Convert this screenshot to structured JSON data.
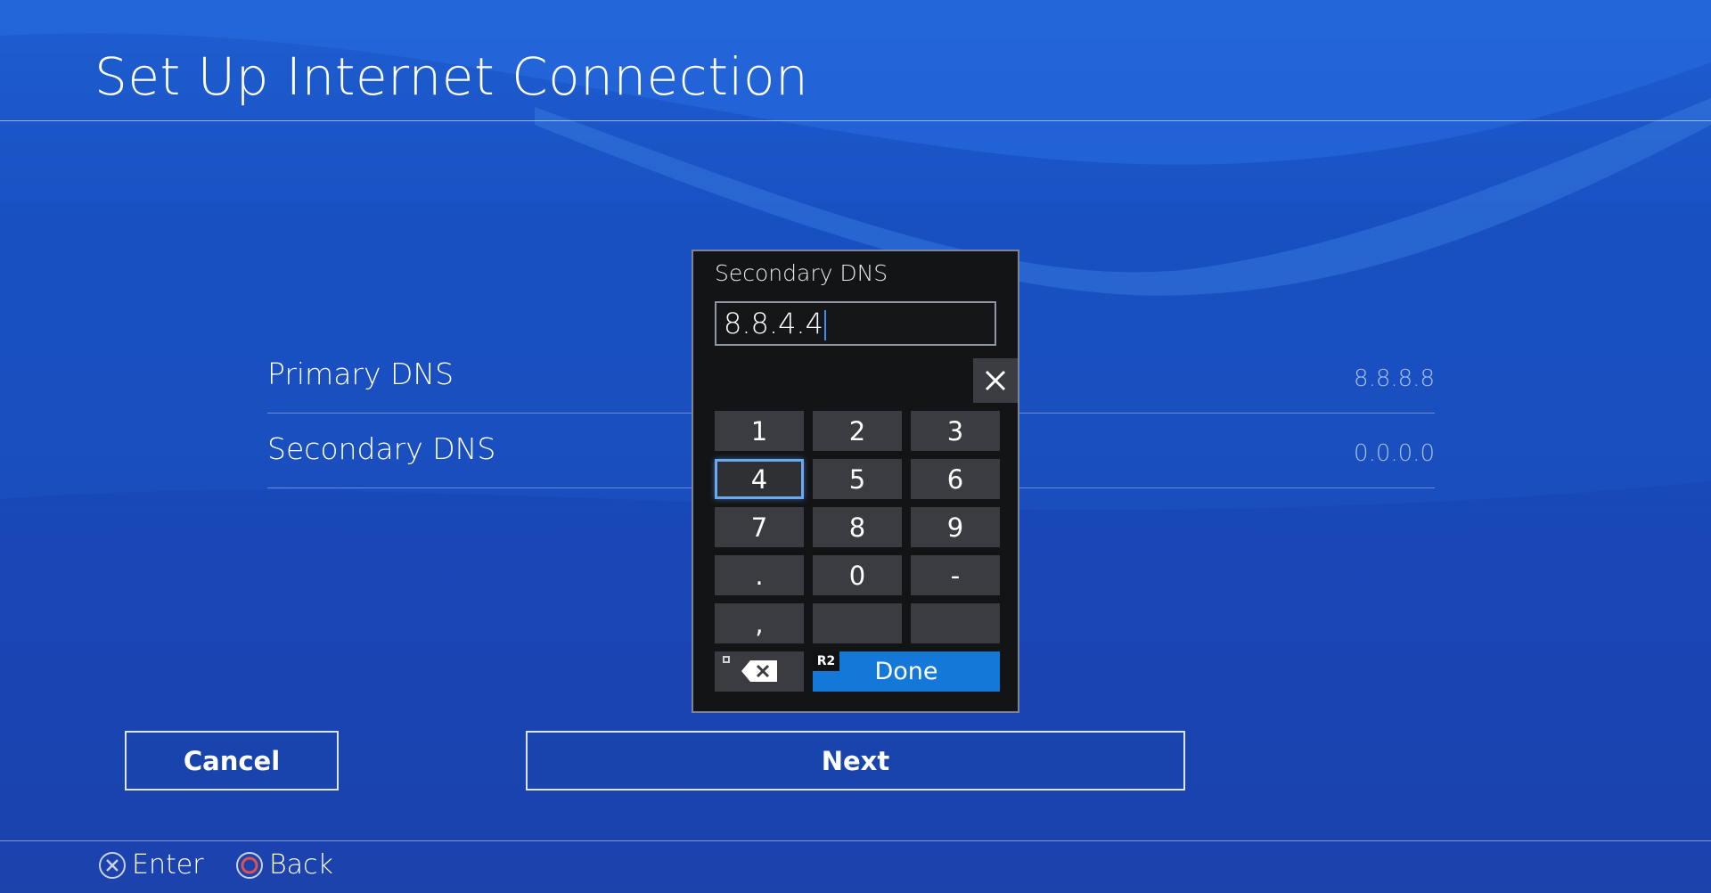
{
  "header": {
    "title": "Set Up Internet Connection"
  },
  "settings": {
    "rows": [
      {
        "label": "Primary DNS",
        "value": "8.8.8.8"
      },
      {
        "label": "Secondary DNS",
        "value": "0.0.0.0"
      }
    ]
  },
  "buttons": {
    "cancel_label": "Cancel",
    "next_label": "Next"
  },
  "hints": {
    "enter_label": "Enter",
    "back_label": "Back"
  },
  "keypad": {
    "title": "Secondary DNS",
    "input_value": "8.8.4.4",
    "keys": [
      "1",
      "2",
      "3",
      "4",
      "5",
      "6",
      "7",
      "8",
      "9",
      ".",
      "0",
      "-",
      ",",
      "",
      ""
    ],
    "focused_key": "4",
    "done_label": "Done",
    "done_shortcut": "R2"
  },
  "colors": {
    "background": "#1a4fc0",
    "dialog_bg": "#131416",
    "key_bg": "#3a3c41",
    "done_button": "#1378d8",
    "focus_ring": "#6aa9f0"
  },
  "icons": {
    "enter": "cross-button-icon",
    "back": "circle-button-icon",
    "clear": "close-icon",
    "backspace": "backspace-icon",
    "square": "square-button-icon"
  }
}
